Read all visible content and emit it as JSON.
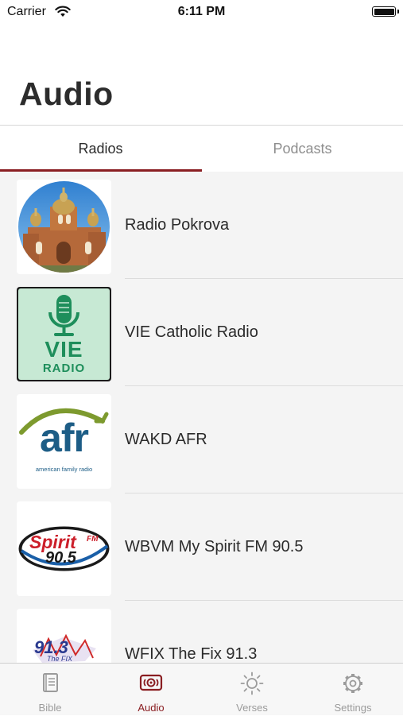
{
  "status_bar": {
    "carrier": "Carrier",
    "time": "6:11 PM"
  },
  "header": {
    "title": "Audio"
  },
  "tabs": [
    {
      "label": "Radios",
      "selected": true
    },
    {
      "label": "Podcasts",
      "selected": false
    }
  ],
  "stations": [
    {
      "name": "Radio Pokrova",
      "icon": "church-photo-logo"
    },
    {
      "name": "VIE Catholic Radio",
      "icon": "microphone-logo",
      "logo_line1": "VIE",
      "logo_line2": "RADIO"
    },
    {
      "name": "WAKD AFR",
      "icon": "afr-logo",
      "logo_text": "afr",
      "logo_caption": "american family radio"
    },
    {
      "name": "WBVM My Spirit FM 90.5",
      "icon": "spirit-fm-logo",
      "logo_word": "Spirit",
      "logo_fm": "FM",
      "logo_freq": "90.5"
    },
    {
      "name": "WFIX The Fix 91.3",
      "icon": "fix-logo",
      "logo_freq": "91.3",
      "logo_sub": "The FIX"
    }
  ],
  "tab_bar": [
    {
      "label": "Bible",
      "icon": "book-icon",
      "active": false
    },
    {
      "label": "Audio",
      "icon": "radio-icon",
      "active": true
    },
    {
      "label": "Verses",
      "icon": "sun-icon",
      "active": false
    },
    {
      "label": "Settings",
      "icon": "gear-icon",
      "active": false
    }
  ],
  "colors": {
    "accent": "#8a1e22",
    "inactive": "#9b9b9b",
    "list_background": "#f4f4f4"
  }
}
